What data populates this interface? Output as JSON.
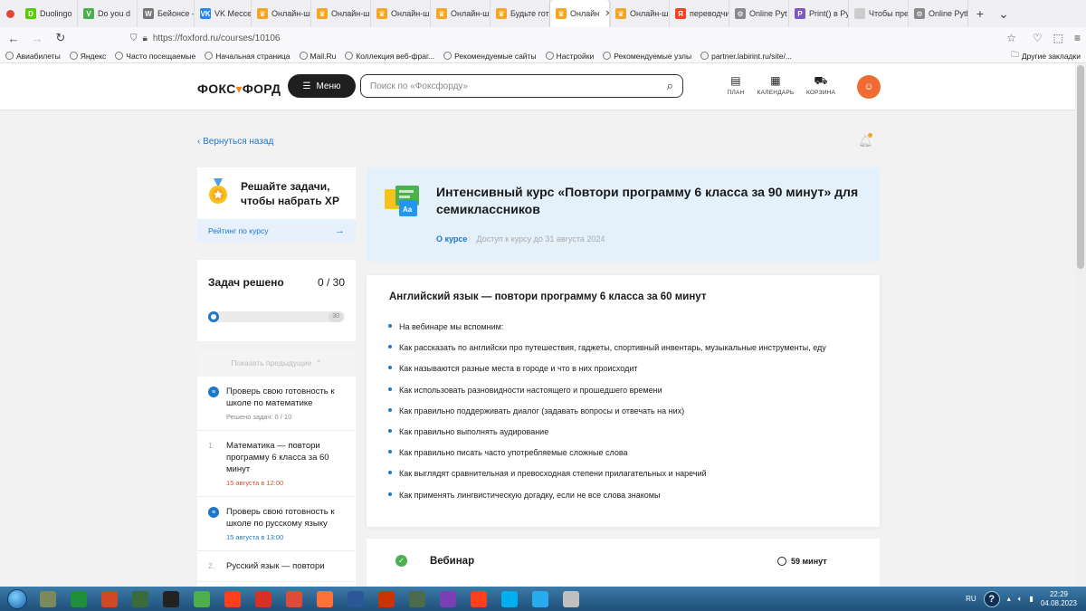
{
  "browser": {
    "tabs": [
      {
        "label": "Duolingo",
        "color": "#58cc02",
        "glyph": "D"
      },
      {
        "label": "Do you d",
        "color": "#4caf50",
        "glyph": "V"
      },
      {
        "label": "Бейонсе –",
        "color": "#777777",
        "glyph": "W"
      },
      {
        "label": "VK Мессе",
        "color": "#2787f5",
        "glyph": "VK"
      },
      {
        "label": "Онлайн-ш",
        "color": "#f5a623",
        "glyph": "♛"
      },
      {
        "label": "Онлайн-ш",
        "color": "#f5a623",
        "glyph": "♛"
      },
      {
        "label": "Онлайн-ш",
        "color": "#f5a623",
        "glyph": "♛"
      },
      {
        "label": "Онлайн-ш",
        "color": "#f5a623",
        "glyph": "♛"
      },
      {
        "label": "Будьте гото",
        "color": "#f5a623",
        "glyph": "♛"
      },
      {
        "label": "Онлайн",
        "color": "#f5a623",
        "glyph": "♛",
        "active": true
      },
      {
        "label": "Онлайн-ш",
        "color": "#f5a623",
        "glyph": "♛"
      },
      {
        "label": "переводчи",
        "color": "#fc3f1d",
        "glyph": "Я"
      },
      {
        "label": "Online Pyt",
        "color": "#8a8a8a",
        "glyph": "⚙"
      },
      {
        "label": "Print() в Py",
        "color": "#7e57c2",
        "glyph": "P"
      },
      {
        "label": "Чтобы презен",
        "color": "#cccccc",
        "glyph": ""
      },
      {
        "label": "Online Pyth",
        "color": "#8a8a8a",
        "glyph": "⚙"
      }
    ],
    "url": "https://foxford.ru/courses/10106",
    "bookmarks": [
      "Авиабилеты",
      "Яндекс",
      "Часто посещаемые",
      "Начальная страница",
      "Mail.Ru",
      "Коллекция веб-фраг...",
      "Рекомендуемые сайты",
      "Настройки",
      "Рекомендуемые узлы",
      "partner.labirint.ru/site/..."
    ],
    "other_bookmarks": "Другие закладки"
  },
  "header": {
    "logo_prefix": "ФОКС",
    "logo_suffix": "ФОРД",
    "menu_label": "Меню",
    "search_placeholder": "Поиск по «Фоксфорду»",
    "nav_plan": "ПЛАН",
    "nav_calendar": "КАЛЕНДАРЬ",
    "nav_cart": "КОРЗИНА"
  },
  "back_link": "Вернуться назад",
  "xp": {
    "title": "Решайте задачи, чтобы набрать XP",
    "rating": "Рейтинг по курсу"
  },
  "progress": {
    "label": "Задач решено",
    "count": "0 / 30",
    "total": "30",
    "solved": 0,
    "max": 30
  },
  "lessons": {
    "show_previous": "Показать предыдущие",
    "items": [
      {
        "kind": "test",
        "title": "Проверь свою готовность к школе по математике",
        "sub": "Решено задач: 0 / 10",
        "sub_style": "grey"
      },
      {
        "kind": "lesson",
        "num": "1.",
        "title": "Математика — повтори программу 6 класса за 60 минут",
        "sub": "15 августа в 12:00",
        "sub_style": "red"
      },
      {
        "kind": "test",
        "title": "Проверь свою готовность к школе по русскому языку",
        "sub": "15 августа в 13:00",
        "sub_style": "blue"
      },
      {
        "kind": "lesson",
        "num": "2.",
        "title": "Русский язык — повтори",
        "sub": "",
        "sub_style": "grey"
      }
    ]
  },
  "course": {
    "title": "Интенсивный курс «Повтори программу 6 класса за 90 минут» для семиклассников",
    "tab_about": "О курсе",
    "access": "Доступ к курсу до 31 августа 2024"
  },
  "description": {
    "title": "Английский язык — повтори программу 6 класса за 60 минут",
    "items": [
      "На вебинаре мы вспомним:",
      "Как рассказать по английски про путешествия, гаджеты, спортивный инвентарь, музыкальные инструменты, еду",
      "Как называются разные места в городе и что в них происходит",
      "Как использовать разновидности настоящего и прошедшего времени",
      "Как правильно поддерживать диалог (задавать вопросы и отвечать на них)",
      "Как правильно выполнять аудирование",
      "Как правильно писать часто употребляемые сложные слова",
      "Как выглядят сравнительная и превосходная степени прилагательных и наречий",
      "Как применять лингвистическую догадку, если не все слова знакомы"
    ]
  },
  "webinar": {
    "title": "Вебинар",
    "duration": "59 минут"
  },
  "taskbar": {
    "apps": [
      "#7a8a5c",
      "#1f8f3a",
      "#d24726",
      "#3a6b3a",
      "#222222",
      "#4cae4c",
      "#fc3f1d",
      "#d93025",
      "#dd4b39",
      "#ff7139",
      "#2b579a",
      "#cc3300",
      "#4b6b4b",
      "#7b3fb5",
      "#fc3f1d",
      "#00aff0",
      "#2aabee",
      "#c0c0c0"
    ],
    "lang": "RU",
    "time": "22:29",
    "date": "04.08.2023"
  },
  "colors": {
    "accent": "#1e78c8",
    "brand_orange": "#f58220",
    "course_header_bg": "#e4f0fa"
  }
}
